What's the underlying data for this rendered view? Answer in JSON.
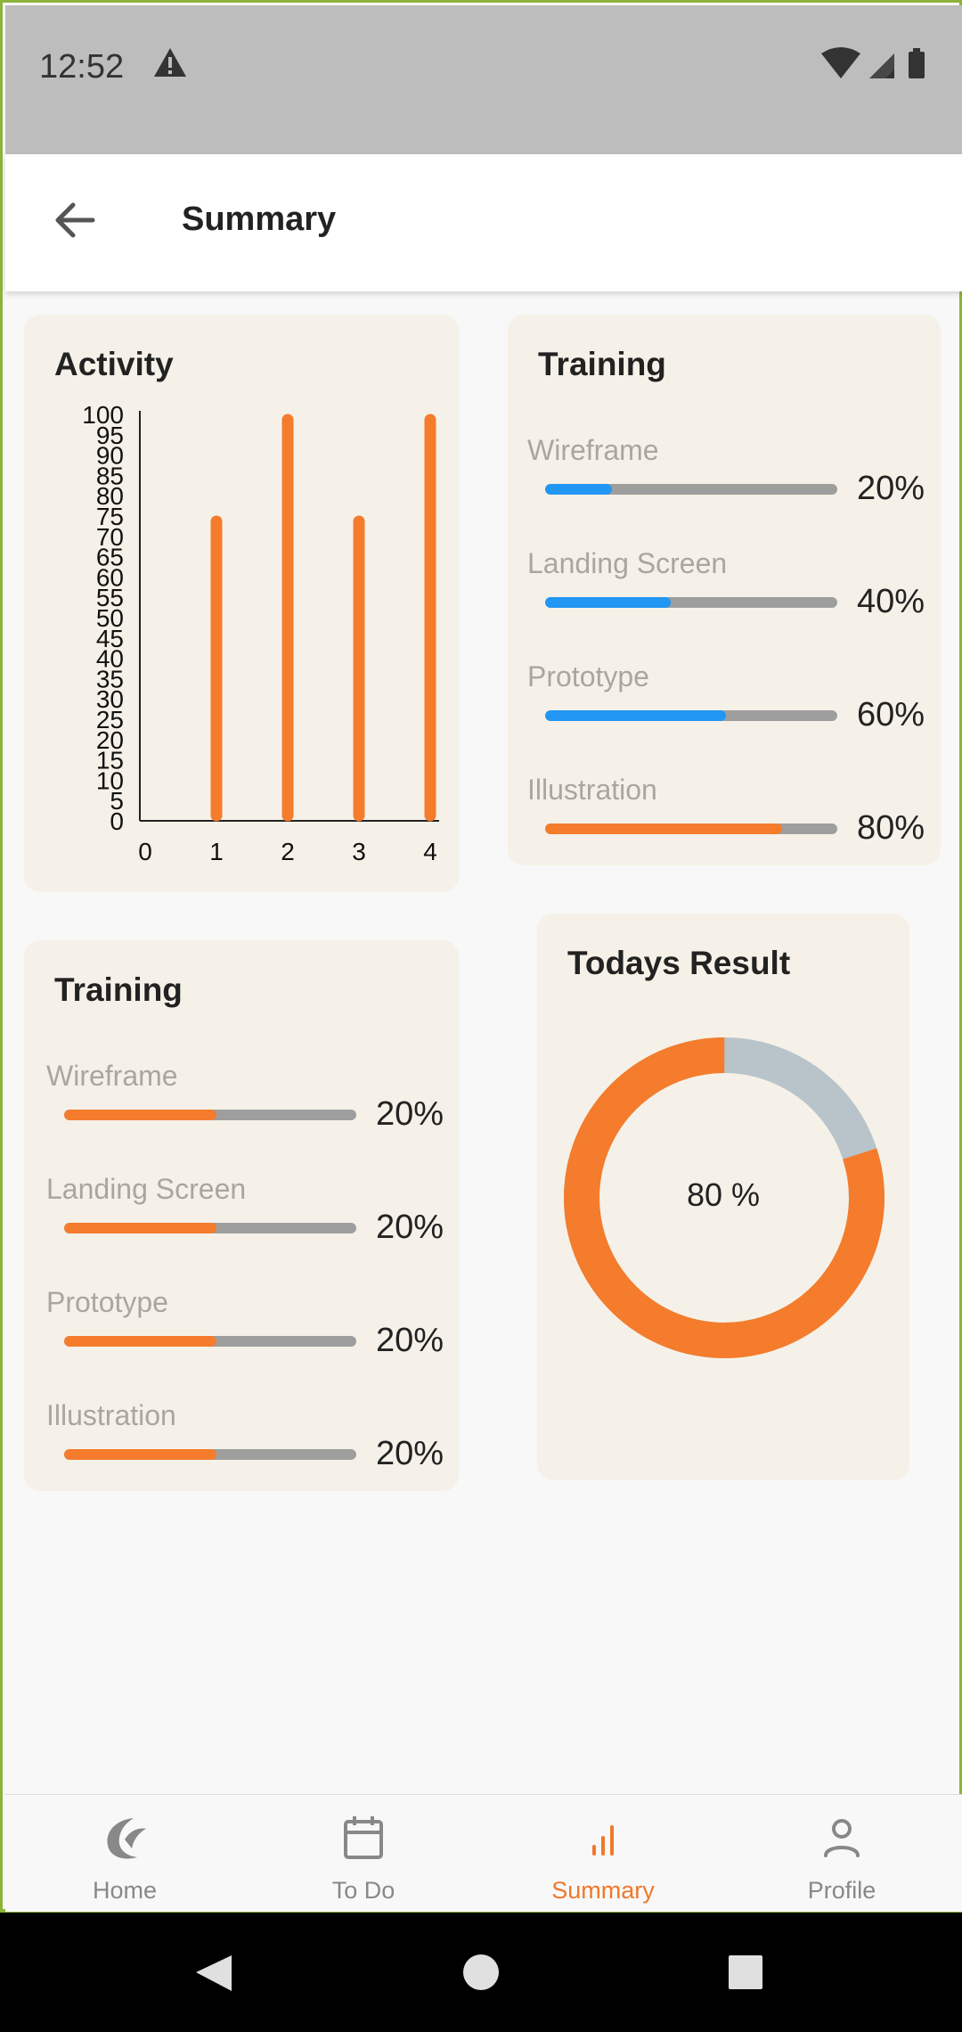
{
  "status_bar": {
    "time": "12:52"
  },
  "app_bar": {
    "title": "Summary"
  },
  "activity_card": {
    "title": "Activity"
  },
  "chart_data": {
    "type": "bar",
    "categories": [
      "0",
      "1",
      "2",
      "3",
      "4"
    ],
    "values": [
      0,
      75,
      100,
      75,
      100
    ],
    "ylim": [
      0,
      100
    ],
    "yticks": [
      "0",
      "5",
      "10",
      "15",
      "20",
      "25",
      "30",
      "35",
      "40",
      "45",
      "50",
      "55",
      "60",
      "65",
      "70",
      "75",
      "80",
      "85",
      "90",
      "95",
      "100"
    ],
    "xlabel": "",
    "ylabel": "",
    "bar_color": "#f47c2c"
  },
  "training_card_top": {
    "title": "Training",
    "items": [
      {
        "label": "Wireframe",
        "value": "20%",
        "fraction": 0.23,
        "color": "#2196f3"
      },
      {
        "label": "Landing Screen",
        "value": "40%",
        "fraction": 0.43,
        "color": "#2196f3"
      },
      {
        "label": "Prototype",
        "value": "60%",
        "fraction": 0.62,
        "color": "#2196f3"
      },
      {
        "label": "Illustration",
        "value": "80%",
        "fraction": 0.81,
        "color": "#f47c2c"
      }
    ]
  },
  "training_card_bottom": {
    "title": "Training",
    "items": [
      {
        "label": "Wireframe",
        "value": "20%",
        "fraction": 0.52,
        "color": "#f47c2c"
      },
      {
        "label": "Landing Screen",
        "value": "20%",
        "fraction": 0.52,
        "color": "#f47c2c"
      },
      {
        "label": "Prototype",
        "value": "20%",
        "fraction": 0.52,
        "color": "#f47c2c"
      },
      {
        "label": "Illustration",
        "value": "20%",
        "fraction": 0.52,
        "color": "#f47c2c"
      }
    ]
  },
  "result_card": {
    "title": "Todays Result",
    "center_text": "80 %",
    "percent": 80,
    "colors": {
      "filled": "#f47c2c",
      "remaining": "#b8c4ca"
    }
  },
  "bottom_nav": {
    "items": [
      {
        "label": "Home",
        "icon": "home-icon",
        "active": false
      },
      {
        "label": "To Do",
        "icon": "calendar-icon",
        "active": false
      },
      {
        "label": "Summary",
        "icon": "bar-chart-icon",
        "active": true
      },
      {
        "label": "Profile",
        "icon": "person-icon",
        "active": false
      }
    ]
  },
  "colors": {
    "accent": "#f47c2c",
    "blue": "#2196f3",
    "card_bg": "#f6f1e8"
  }
}
